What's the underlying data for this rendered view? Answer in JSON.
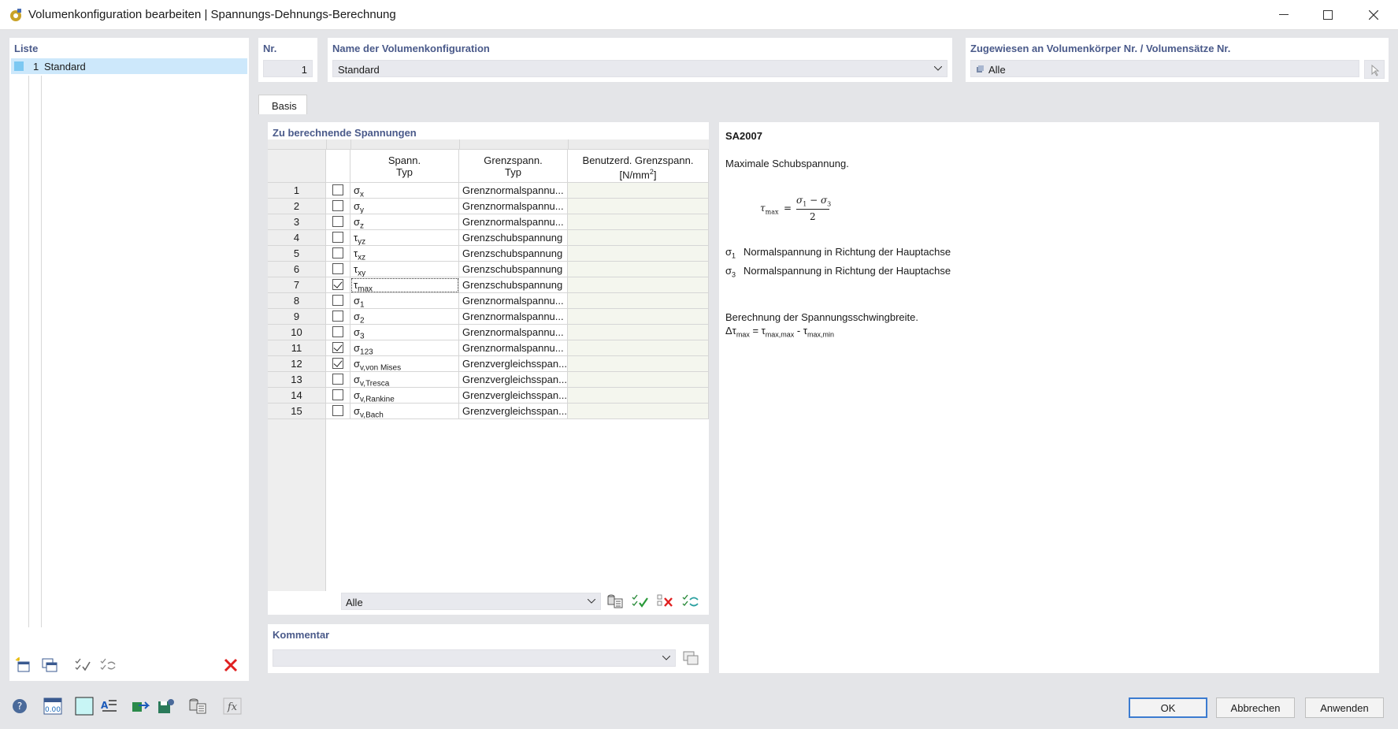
{
  "window": {
    "title": "Volumenkonfiguration bearbeiten | Spannungs-Dehnungs-Berechnung"
  },
  "list": {
    "title": "Liste",
    "items": [
      {
        "number": "1",
        "label": "Standard",
        "color": "#7cc8f2"
      }
    ]
  },
  "header": {
    "nr_label": "Nr.",
    "nr_value": "1",
    "name_label": "Name der Volumenkonfiguration",
    "name_value": "Standard",
    "assigned_label": "Zugewiesen an Volumenkörper Nr. / Volumensätze Nr.",
    "assigned_value": "Alle"
  },
  "tabs": [
    {
      "label": "Basis",
      "active": true
    }
  ],
  "stresses": {
    "title": "Zu berechnende Spannungen",
    "columns": {
      "type_line1": "Spann.",
      "type_line2": "Typ",
      "limit_line1": "Grenzspann.",
      "limit_line2": "Typ",
      "user_line1": "Benutzerd. Grenzspann.",
      "user_unit": "[N/mm",
      "user_unit_sup": "2",
      "user_unit_end": "]"
    },
    "rows": [
      {
        "no": "1",
        "checked": false,
        "sym": "σ",
        "sub": "x",
        "limit": "Grenznormalspannu..."
      },
      {
        "no": "2",
        "checked": false,
        "sym": "σ",
        "sub": "y",
        "limit": "Grenznormalspannu..."
      },
      {
        "no": "3",
        "checked": false,
        "sym": "σ",
        "sub": "z",
        "limit": "Grenznormalspannu..."
      },
      {
        "no": "4",
        "checked": false,
        "sym": "τ",
        "sub": "yz",
        "limit": "Grenzschubspannung"
      },
      {
        "no": "5",
        "checked": false,
        "sym": "τ",
        "sub": "xz",
        "limit": "Grenzschubspannung"
      },
      {
        "no": "6",
        "checked": false,
        "sym": "τ",
        "sub": "xy",
        "limit": "Grenzschubspannung"
      },
      {
        "no": "7",
        "checked": true,
        "sym": "τ",
        "sub": "max",
        "limit": "Grenzschubspannung"
      },
      {
        "no": "8",
        "checked": false,
        "sym": "σ",
        "sub": "1",
        "limit": "Grenznormalspannu..."
      },
      {
        "no": "9",
        "checked": false,
        "sym": "σ",
        "sub": "2",
        "limit": "Grenznormalspannu..."
      },
      {
        "no": "10",
        "checked": false,
        "sym": "σ",
        "sub": "3",
        "limit": "Grenznormalspannu..."
      },
      {
        "no": "11",
        "checked": true,
        "sym": "σ",
        "sub": "123",
        "limit": "Grenznormalspannu..."
      },
      {
        "no": "12",
        "checked": true,
        "sym": "σ",
        "sub": "v,von Mises",
        "limit": "Grenzvergleichsspan..."
      },
      {
        "no": "13",
        "checked": false,
        "sym": "σ",
        "sub": "v,Tresca",
        "limit": "Grenzvergleichsspan..."
      },
      {
        "no": "14",
        "checked": false,
        "sym": "σ",
        "sub": "v,Rankine",
        "limit": "Grenzvergleichsspan..."
      },
      {
        "no": "15",
        "checked": false,
        "sym": "σ",
        "sub": "v,Bach",
        "limit": "Grenzvergleichsspan..."
      }
    ],
    "filter_value": "Alle"
  },
  "comment": {
    "title": "Kommentar",
    "value": ""
  },
  "info": {
    "code": "SA2007",
    "description": "Maximale Schubspannung.",
    "formula": {
      "lhs": "τ",
      "lhs_sub": "max",
      "eq": "=",
      "num": "σ",
      "num_sub1": "1",
      "minus": " − σ",
      "num_sub2": "3",
      "den": "2"
    },
    "legend": [
      {
        "sym": "σ",
        "sub": "1",
        "text": "Normalspannung in Richtung der Hauptachse"
      },
      {
        "sym": "σ",
        "sub": "3",
        "text": "Normalspannung in Richtung der Hauptachse"
      }
    ],
    "range_text": "Berechnung der Spannungsschwingbreite.",
    "range_formula": {
      "d": "Δτ",
      "d_sub": "max",
      "eq": " = τ",
      "a_sub": "max,max",
      "minus": " - τ",
      "b_sub": "max,min"
    }
  },
  "buttons": {
    "ok": "OK",
    "cancel": "Abbrechen",
    "apply": "Anwenden"
  },
  "colors": {
    "accent": "#3b7bd0",
    "header_text": "#4a5a8a",
    "selected_row": "#cde8fb",
    "delete_red": "#e02020"
  }
}
